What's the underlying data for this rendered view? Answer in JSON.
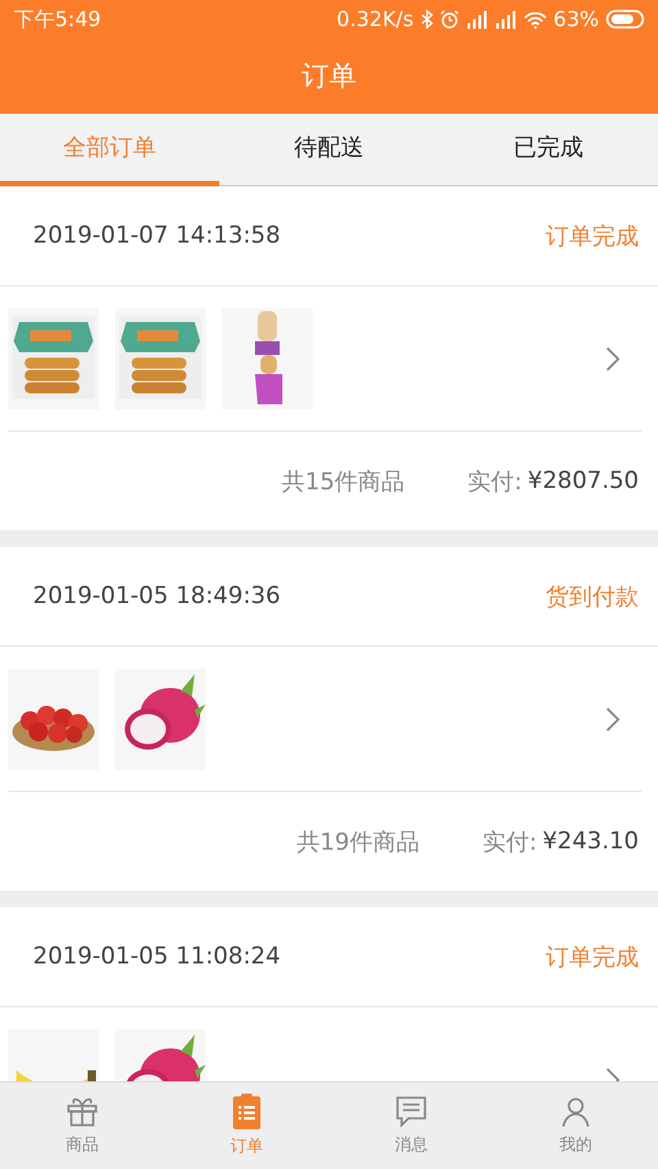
{
  "status_bar": {
    "time": "下午5:49",
    "speed": "0.32K/s",
    "battery": "63%"
  },
  "header": {
    "title": "订单"
  },
  "tabs": [
    {
      "label": "全部订单",
      "selected": true
    },
    {
      "label": "待配送",
      "selected": false
    },
    {
      "label": "已完成",
      "selected": false
    }
  ],
  "orders": [
    {
      "date": "2019-01-07 14:13:58",
      "status": "订单完成",
      "count": "共15件商品",
      "paid_label": "实付:",
      "paid": "¥2807.50"
    },
    {
      "date": "2019-01-05 18:49:36",
      "status": "货到付款",
      "count": "共19件商品",
      "paid_label": "实付:",
      "paid": "¥243.10"
    },
    {
      "date": "2019-01-05 11:08:24",
      "status": "订单完成"
    }
  ],
  "nav": [
    {
      "label": "商品",
      "selected": false
    },
    {
      "label": "订单",
      "selected": true
    },
    {
      "label": "消息",
      "selected": false
    },
    {
      "label": "我的",
      "selected": false
    }
  ]
}
